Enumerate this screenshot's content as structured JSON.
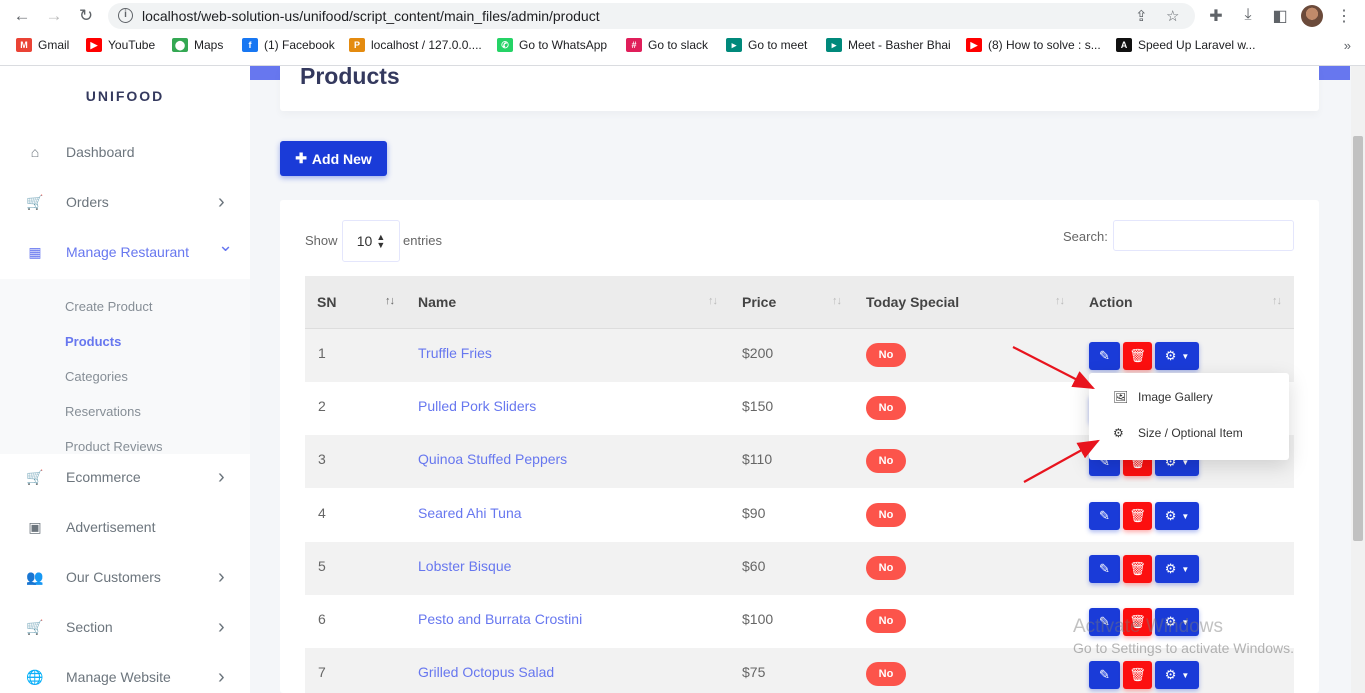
{
  "browser": {
    "url": "localhost/web-solution-us/unifood/script_content/main_files/admin/product",
    "bookmarks": [
      {
        "label": "Gmail",
        "color": "#ea4335",
        "glyph": "M"
      },
      {
        "label": "YouTube",
        "color": "#ff0000",
        "glyph": "▶"
      },
      {
        "label": "Maps",
        "color": "#34a853",
        "glyph": "⬤"
      },
      {
        "label": "(1) Facebook",
        "color": "#1877f2",
        "glyph": "f"
      },
      {
        "label": "localhost / 127.0.0....",
        "color": "#e48b0f",
        "glyph": "P"
      },
      {
        "label": "Go to WhatsApp",
        "color": "#25d366",
        "glyph": "✆"
      },
      {
        "label": "Go to slack",
        "color": "#e01e5a",
        "glyph": "#"
      },
      {
        "label": "Go to meet",
        "color": "#00897b",
        "glyph": "▸"
      },
      {
        "label": "Meet - Basher Bhai",
        "color": "#00897b",
        "glyph": "▸"
      },
      {
        "label": "(8) How to solve : s...",
        "color": "#ff0000",
        "glyph": "▶"
      },
      {
        "label": "Speed Up Laravel w...",
        "color": "#111111",
        "glyph": "A"
      }
    ]
  },
  "sidebar": {
    "brand": "UNIFOOD",
    "items": [
      {
        "label": "Dashboard",
        "icon": "home-icon",
        "glyph": "⌂",
        "chevron": ""
      },
      {
        "label": "Orders",
        "icon": "cart-icon",
        "glyph": "🛒",
        "chevron": "›"
      },
      {
        "label": "Manage Restaurant",
        "icon": "grid-icon",
        "glyph": "▦",
        "chevron": "⌄"
      },
      {
        "label": "Ecommerce",
        "icon": "cart-icon",
        "glyph": "🛒",
        "chevron": "›"
      },
      {
        "label": "Advertisement",
        "icon": "ad-icon",
        "glyph": "▣",
        "chevron": ""
      },
      {
        "label": "Our Customers",
        "icon": "users-icon",
        "glyph": "👥",
        "chevron": "›"
      },
      {
        "label": "Section",
        "icon": "cart-icon",
        "glyph": "🛒",
        "chevron": "›"
      },
      {
        "label": "Manage Website",
        "icon": "globe-icon",
        "glyph": "🌐",
        "chevron": "›"
      }
    ],
    "submenu": [
      "Create Product",
      "Products",
      "Categories",
      "Reservations",
      "Product Reviews"
    ]
  },
  "main": {
    "title": "Products",
    "add_button": "Add New",
    "show_label": "Show",
    "entries_value": "10",
    "entries_label": "entries",
    "search_label": "Search:",
    "columns": [
      "SN",
      "Name",
      "Price",
      "Today Special",
      "Action"
    ],
    "rows": [
      {
        "sn": "1",
        "name": "Truffle Fries",
        "price": "$200",
        "special": "No"
      },
      {
        "sn": "2",
        "name": "Pulled Pork Sliders",
        "price": "$150",
        "special": "No"
      },
      {
        "sn": "3",
        "name": "Quinoa Stuffed Peppers",
        "price": "$110",
        "special": "No"
      },
      {
        "sn": "4",
        "name": "Seared Ahi Tuna",
        "price": "$90",
        "special": "No"
      },
      {
        "sn": "5",
        "name": "Lobster Bisque",
        "price": "$60",
        "special": "No"
      },
      {
        "sn": "6",
        "name": "Pesto and Burrata Crostini",
        "price": "$100",
        "special": "No"
      },
      {
        "sn": "7",
        "name": "Grilled Octopus Salad",
        "price": "$75",
        "special": "No"
      }
    ],
    "dropdown": [
      {
        "label": "Image Gallery",
        "icon": "image-icon"
      },
      {
        "label": "Size / Optional Item",
        "icon": "gear-icon"
      }
    ]
  },
  "watermark": {
    "line1": "Activate Windows",
    "line2": "Go to Settings to activate Windows."
  },
  "colors": {
    "accent": "#6777ef",
    "primary_button": "#1a3bd8",
    "danger": "#fc544b",
    "arrow": "#e8141e"
  }
}
